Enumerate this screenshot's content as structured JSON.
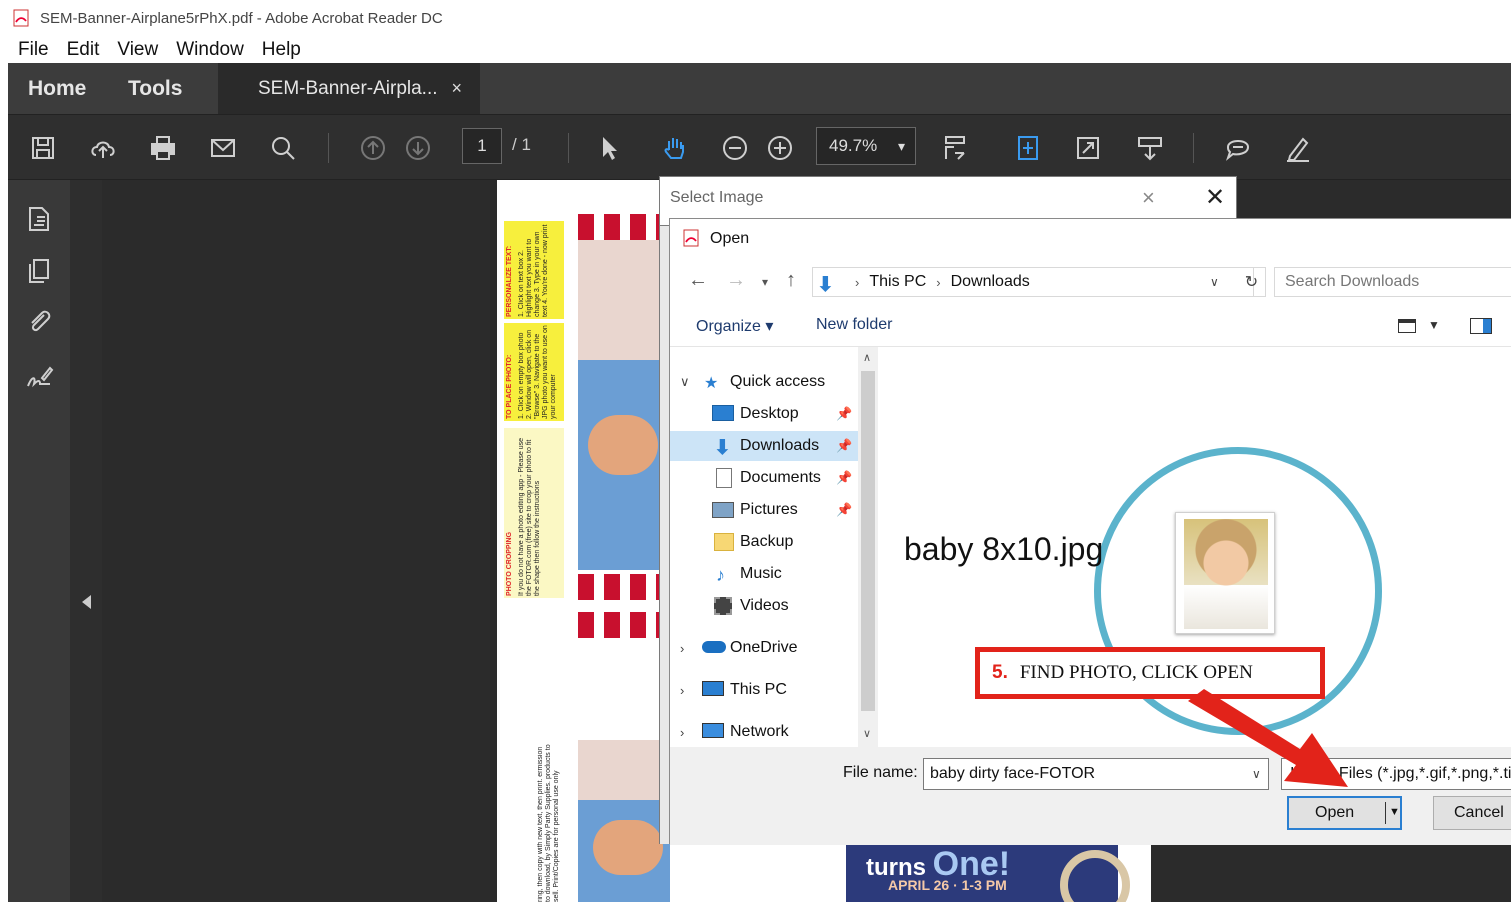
{
  "window": {
    "title": "SEM-Banner-Airplane5rPhX.pdf - Adobe Acrobat Reader DC"
  },
  "menu": [
    "File",
    "Edit",
    "View",
    "Window",
    "Help"
  ],
  "tabs": {
    "home": "Home",
    "tools": "Tools",
    "document": "SEM-Banner-Airpla...",
    "close": "×"
  },
  "toolbar": {
    "page_current": "1",
    "page_total": "/ 1",
    "zoom": "49.7%"
  },
  "document_page": {
    "block1_title": "PERSONALIZE TEXT:",
    "block1_text": "1. Click on text box 2. Highlight text you want to change 3. Type in your own text 4. You're done - now print",
    "block2_title": "TO PLACE PHOTO:",
    "block2_text": "1. Click on empty box photo 2. Window will open, click on \"Browse\" 3. Navigate to the JPG photo you want to use on your computer",
    "block3_title": "PHOTO CROPPING",
    "block3_text": "If you do not have a photo editing app - Please use the FOTOR.com (free) site to crop your photo to fit the shape then follow the instructions",
    "rot_text": "ring, then copy with new text, then print. ermission to download, by Simply Party Supplies. products to sell. Print/Copies are for personal use only",
    "banner_line1": "turns ",
    "banner_big": "One!",
    "banner_line2": "APRIL 26 · 1-3 PM"
  },
  "select_image_dialog": {
    "title": "Select Image"
  },
  "open_dialog": {
    "title": "Open",
    "path": [
      "This PC",
      "Downloads"
    ],
    "search_placeholder": "Search Downloads",
    "organize": "Organize ▾",
    "new_folder": "New folder",
    "nav": {
      "quick_access": "Quick access",
      "desktop": "Desktop",
      "downloads": "Downloads",
      "documents": "Documents",
      "pictures": "Pictures",
      "backup": "Backup",
      "music": "Music",
      "videos": "Videos",
      "onedrive": "OneDrive",
      "this_pc": "This PC",
      "network": "Network"
    },
    "file": {
      "name": "baby 8x10.jpg"
    },
    "callout": {
      "step": "5.",
      "text": "FIND PHOTO, CLICK OPEN"
    },
    "file_name_label": "File name:",
    "file_name_value": "baby dirty face-FOTOR",
    "file_type": "Image Files (*.jpg,*.gif,*.png,*.tif",
    "open_button": "Open",
    "cancel_button": "Cancel"
  },
  "colors": {
    "accent_blue": "#2a7fd1",
    "callout_red": "#e2231a",
    "circle_blue": "#5bb3cc",
    "tab_bg": "#3c3c3c"
  }
}
